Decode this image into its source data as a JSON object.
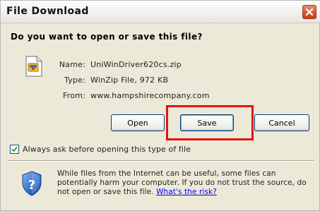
{
  "window": {
    "title": "File Download"
  },
  "prompt": {
    "heading": "Do you want to open or save this file?"
  },
  "file": {
    "icon": "winzip-file-icon",
    "name_label": "Name:",
    "name_value": "UniWinDriver620cs.zip",
    "type_label": "Type:",
    "type_value": "WinZip File, 972 KB",
    "from_label": "From:",
    "from_value": "www.hampshirecompany.com"
  },
  "buttons": {
    "open": "Open",
    "save": "Save",
    "cancel": "Cancel"
  },
  "checkbox": {
    "label": "Always ask before opening this type of file",
    "checked": true
  },
  "warning": {
    "icon": "security-shield-icon",
    "text": "While files from the Internet can be useful, some files can potentially harm your computer. If you do not trust the source, do not open or save this file.",
    "link": "What's the risk?"
  },
  "colors": {
    "highlight": "#e81010",
    "close_button": "#d65834",
    "link": "#0000ff"
  }
}
